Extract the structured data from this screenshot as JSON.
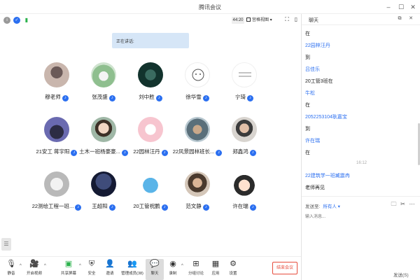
{
  "window": {
    "title": "腾讯会议"
  },
  "topbar": {
    "timer": "44:20",
    "view_mode": "宫格视图"
  },
  "stage": {
    "speaking_label": "正在讲话:",
    "participants": [
      {
        "name": "穆老师"
      },
      {
        "name": "张茂盛"
      },
      {
        "name": "刘中胜"
      },
      {
        "name": "徐华雪"
      },
      {
        "name": "宁琦"
      },
      {
        "name": "21安工 蒋宇阳"
      },
      {
        "name": "土木一班杨豪豪..."
      },
      {
        "name": "22园林汪丹"
      },
      {
        "name": "22风景园林班长..."
      },
      {
        "name": "郑鑫鸿"
      },
      {
        "name": "22测绘工程一班..."
      },
      {
        "name": "王超阳"
      },
      {
        "name": "20工管祝鹏"
      },
      {
        "name": "范文静"
      },
      {
        "name": "许在瑞"
      }
    ]
  },
  "toolbar": {
    "mute": "静音",
    "video": "开启视频",
    "share": "共享屏幕",
    "security": "安全",
    "invite": "邀请",
    "members": "管理成员(38)",
    "chat": "聊天",
    "record": "录制",
    "breakout": "分组讨论",
    "apps": "应用",
    "settings": "设置",
    "end": "结束会议"
  },
  "chat": {
    "title": "聊天",
    "messages": [
      {
        "text": "在",
        "style": "plain"
      },
      {
        "text": "22园林汪丹",
        "style": "blue"
      },
      {
        "text": "到",
        "style": "plain"
      },
      {
        "text": "吕佳乐",
        "style": "blue"
      },
      {
        "text": "20工管3班在",
        "style": "plain"
      },
      {
        "text": "牛松",
        "style": "blue"
      },
      {
        "text": "在",
        "style": "plain"
      },
      {
        "text": "2052253104耿嘉宝",
        "style": "blue"
      },
      {
        "text": "到",
        "style": "plain"
      },
      {
        "text": "许在瑞",
        "style": "blue"
      },
      {
        "text": "在",
        "style": "plain"
      },
      {
        "text": "16:12",
        "style": "time"
      },
      {
        "text": "22建筑学一班臧震冉",
        "style": "blue"
      },
      {
        "text": "老师再见",
        "style": "plain"
      }
    ],
    "send_to_label": "发送至:",
    "send_to_value": "所有人",
    "input_placeholder": "输入消息...",
    "send_label": "发送(S)"
  },
  "colors": {
    "accent": "#2b6ff0",
    "end": "#e74c3c",
    "speaking_bg": "#d6e6f7"
  }
}
